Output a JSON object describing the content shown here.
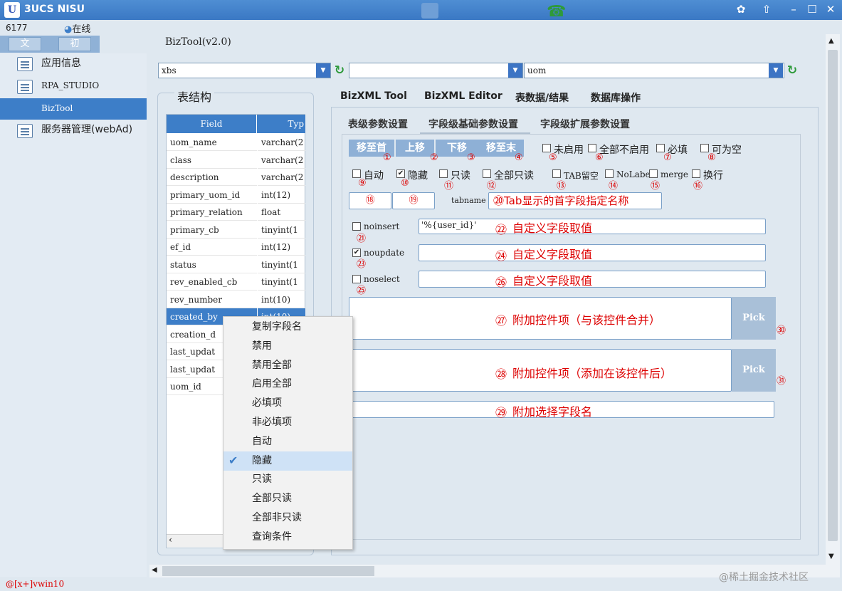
{
  "window": {
    "title": "3UCS NISU",
    "logo_text": "U",
    "user_id": "6177",
    "online_status": "在线"
  },
  "nav_tabs": [
    "文",
    "初"
  ],
  "sidebar": {
    "items": [
      {
        "label": "应用信息"
      },
      {
        "label": "RPA_STUDIO"
      },
      {
        "label": "BizTool"
      },
      {
        "label": "服务器管理(webAd)"
      }
    ]
  },
  "main": {
    "title": "BizTool(v2.0)",
    "combo1": "xbs",
    "combo2": "",
    "combo3": "uom",
    "table_structure_title": "表结构",
    "grid": {
      "headers": [
        "Field",
        "Typ"
      ],
      "rows": [
        [
          "uom_name",
          "varchar(2"
        ],
        [
          "class",
          "varchar(2"
        ],
        [
          "description",
          "varchar(2"
        ],
        [
          "primary_uom_id",
          "int(12)"
        ],
        [
          "primary_relation",
          "float"
        ],
        [
          "primary_cb",
          "tinyint(1"
        ],
        [
          "ef_id",
          "int(12)"
        ],
        [
          "status",
          "tinyint(1"
        ],
        [
          "rev_enabled_cb",
          "tinyint(1"
        ],
        [
          "rev_number",
          "int(10)"
        ],
        [
          "created_by",
          "int(10)"
        ],
        [
          "creation_d",
          ""
        ],
        [
          "last_updat",
          ""
        ],
        [
          "last_updat",
          ""
        ],
        [
          "uom_id",
          ""
        ]
      ]
    },
    "tabs": [
      "BizXML Tool",
      "BizXML Editor",
      "表数据/结果",
      "数据库操作"
    ],
    "sub_tabs": [
      "表级参数设置",
      "字段级基础参数设置",
      "字段级扩展参数设置"
    ],
    "buttons": [
      "移至首",
      "上移",
      "下移",
      "移至末"
    ],
    "checks_row1": [
      "未启用",
      "全部不启用",
      "必填",
      "可为空"
    ],
    "checks_row2": [
      "自动",
      "隐藏",
      "只读",
      "全部只读",
      "TAB留空",
      "NoLabe",
      "merge",
      "换行"
    ],
    "tabname_label": "tabname",
    "tabname_hint": "⑳Tab显示的首字段指定名称",
    "noinsert_label": "noinsert",
    "noinsert_value": "'%{user_id}'",
    "noupdate_label": "noupdate",
    "noselect_label": "noselect",
    "custom_value_hint": "自定义字段取值",
    "extra_control_merge": "附加控件项（与该控件合并）",
    "extra_control_after": "附加控件项（添加在该控件后）",
    "extra_select_field": "附加选择字段名",
    "pick_label": "Pick",
    "markers": [
      "①",
      "②",
      "③",
      "④",
      "⑤",
      "⑥",
      "⑦",
      "⑧",
      "⑨",
      "⑩",
      "⑪",
      "⑫",
      "⑬",
      "⑭",
      "⑮",
      "⑯",
      "⑱",
      "⑲",
      "㉑",
      "㉒",
      "㉓",
      "㉔",
      "㉕",
      "㉖",
      "㉗",
      "㉘",
      "㉙",
      "㉚",
      "㉛"
    ]
  },
  "context_menu": {
    "items": [
      "复制字段名",
      "禁用",
      "禁用全部",
      "启用全部",
      "必填项",
      "非必填项",
      "自动",
      "隐藏",
      "只读",
      "全部只读",
      "全部非只读",
      "查询条件"
    ],
    "checked_item": "隐藏"
  },
  "status_bar": "@[x+]vwin10",
  "watermark": "@稀土掘金技术社区"
}
